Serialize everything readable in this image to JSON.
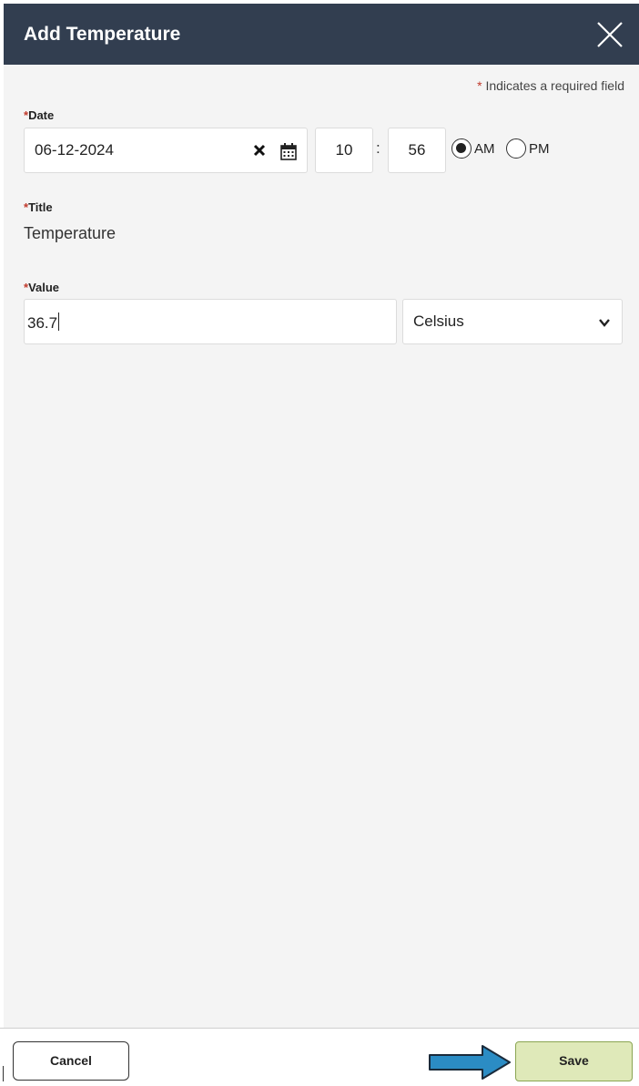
{
  "header": {
    "title": "Add Temperature"
  },
  "form": {
    "required_star": "*",
    "required_note": "Indicates a required field",
    "date": {
      "label": "Date",
      "value": "06-12-2024",
      "clear_icon": "x-icon",
      "calendar_icon": "calendar-icon"
    },
    "time": {
      "hour": "10",
      "separator": ":",
      "minute": "56",
      "am_label": "AM",
      "pm_label": "PM",
      "selected": "AM"
    },
    "title_field": {
      "label": "Title",
      "value": "Temperature"
    },
    "value_field": {
      "label": "Value",
      "value": "36.7"
    },
    "unit": {
      "selected": "Celsius"
    }
  },
  "footer": {
    "cancel_label": "Cancel",
    "save_label": "Save"
  },
  "colors": {
    "header_bg": "#323e50",
    "save_bg": "#dfe9b9",
    "arrow": "#2b8cc4"
  }
}
